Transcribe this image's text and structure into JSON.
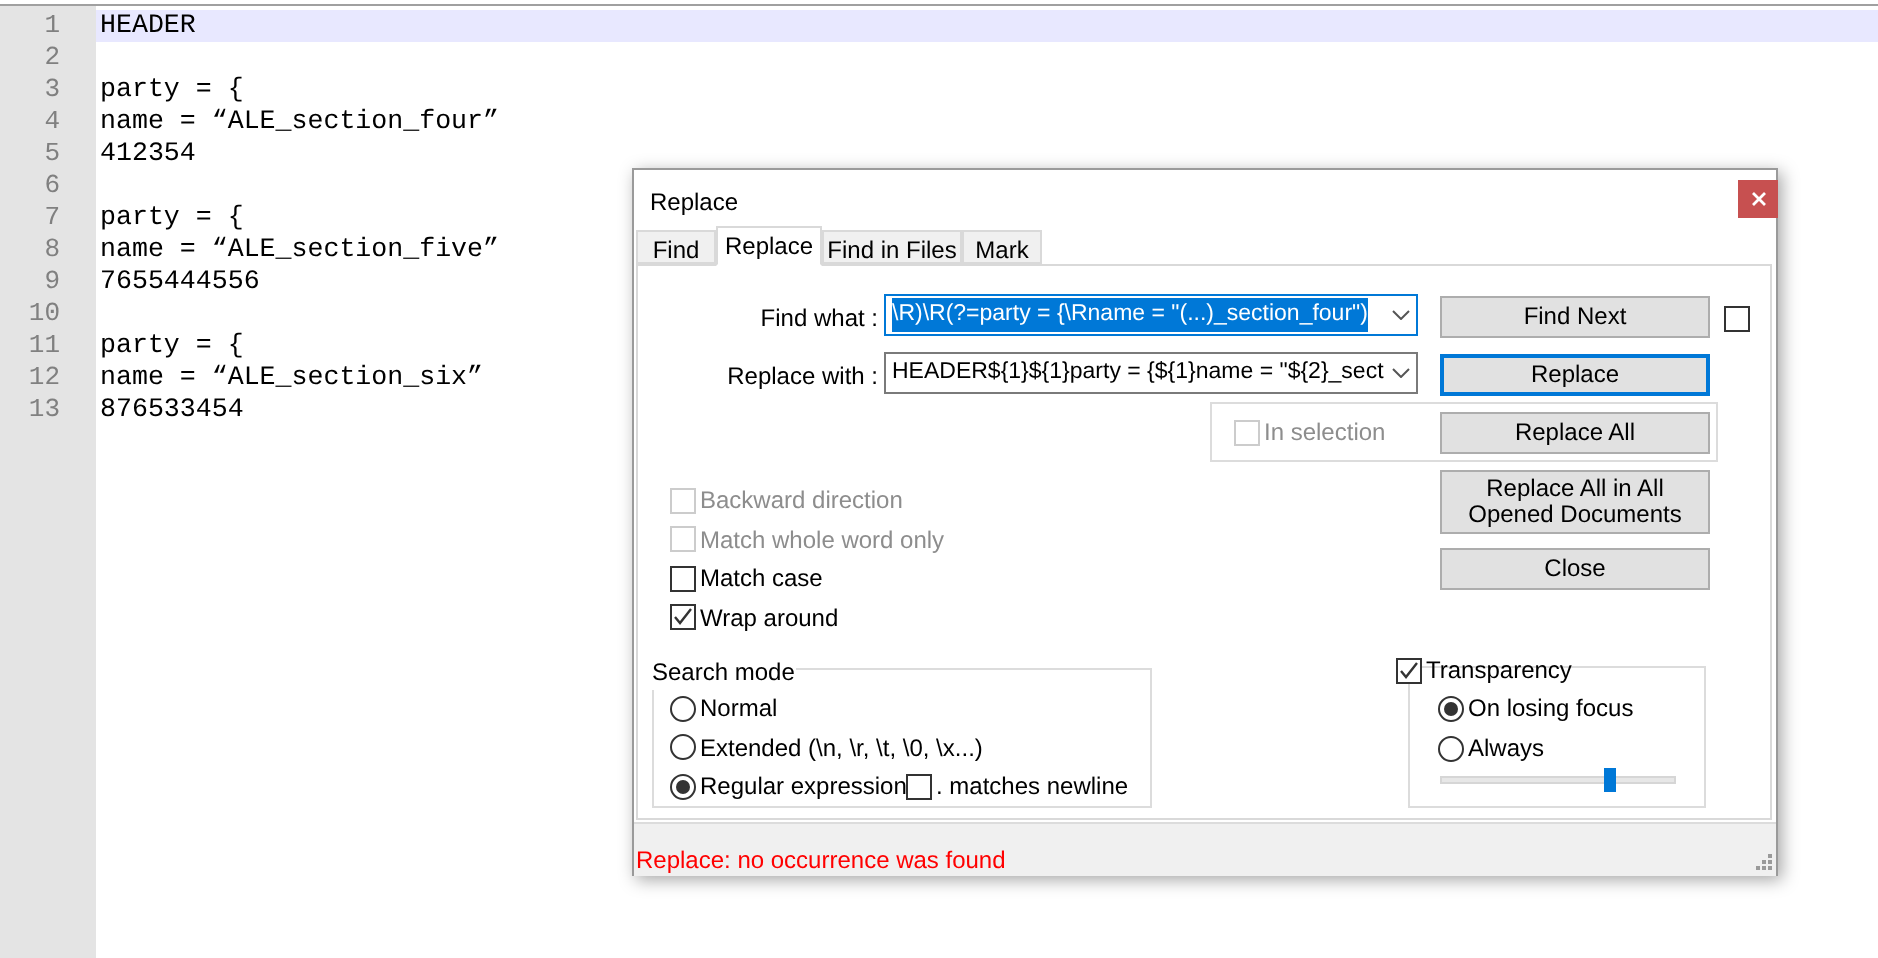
{
  "editor": {
    "lines": [
      {
        "number": "1",
        "text": "HEADER",
        "current": true
      },
      {
        "number": "2",
        "current": false
      },
      {
        "number": "3",
        "text": "party = {",
        "current": false
      },
      {
        "number": "4",
        "text": "name = “ALE_section_four”",
        "current": false
      },
      {
        "number": "5",
        "text": "412354",
        "current": false
      },
      {
        "number": "6",
        "current": false
      },
      {
        "number": "7",
        "text": "party = {",
        "current": false
      },
      {
        "number": "8",
        "text": "name = “ALE_section_five”",
        "current": false
      },
      {
        "number": "9",
        "text": "7655444556",
        "current": false
      },
      {
        "number": "10",
        "current": false
      },
      {
        "number": "11",
        "text": "party = {",
        "current": false
      },
      {
        "number": "12",
        "text": "name = “ALE_section_six”",
        "current": false
      },
      {
        "number": "13",
        "text": "876533454",
        "current": false
      }
    ]
  },
  "dialog": {
    "title": "Replace",
    "tabs": [
      {
        "label": "Find",
        "selected": false
      },
      {
        "label": "Replace",
        "selected": true
      },
      {
        "label": "Find in Files",
        "selected": false
      },
      {
        "label": "Mark",
        "selected": false
      }
    ],
    "fields": [
      {
        "label": "Find what :",
        "value": "\\R)\\R(?=party = {\\Rname = \"(...)_section_four\")",
        "text_selected": true
      },
      {
        "label": "Replace with :",
        "value": "HEADER${1}${1}party = {${1}name = \"${2}_sect",
        "text_selected": false
      }
    ],
    "side_checkbox": {
      "checked": false
    },
    "buttons": [
      {
        "label": "Find Next",
        "focused": false
      },
      {
        "label": "Replace",
        "focused": true
      },
      {
        "label": "Replace All",
        "focused": false
      },
      {
        "label": "Replace All in All Opened Documents",
        "focused": false
      },
      {
        "label": "Close",
        "focused": false
      }
    ],
    "in_selection": {
      "label": "In selection",
      "checked": false,
      "disabled": true
    },
    "options": [
      {
        "label": "Backward direction",
        "checked": false,
        "disabled": true
      },
      {
        "label": "Match whole word only",
        "checked": false,
        "disabled": true
      },
      {
        "label": "Match case",
        "checked": false,
        "disabled": false
      },
      {
        "label": "Wrap around",
        "checked": true,
        "disabled": false
      }
    ],
    "search_mode": {
      "title": "Search mode",
      "modes": [
        {
          "label": "Normal",
          "selected": false
        },
        {
          "label": "Extended (\\n, \\r, \\t, \\0, \\x...)",
          "selected": false
        },
        {
          "label": "Regular expression",
          "selected": true
        }
      ],
      "dot_matches_newline": {
        "label": ". matches newline",
        "checked": false
      }
    },
    "transparency": {
      "label": "Transparency",
      "checked": true,
      "modes": [
        {
          "label": "On losing focus",
          "selected": true
        },
        {
          "label": "Always",
          "selected": false
        }
      ],
      "level": 0.72
    },
    "status": "Replace: no occurrence was found"
  }
}
